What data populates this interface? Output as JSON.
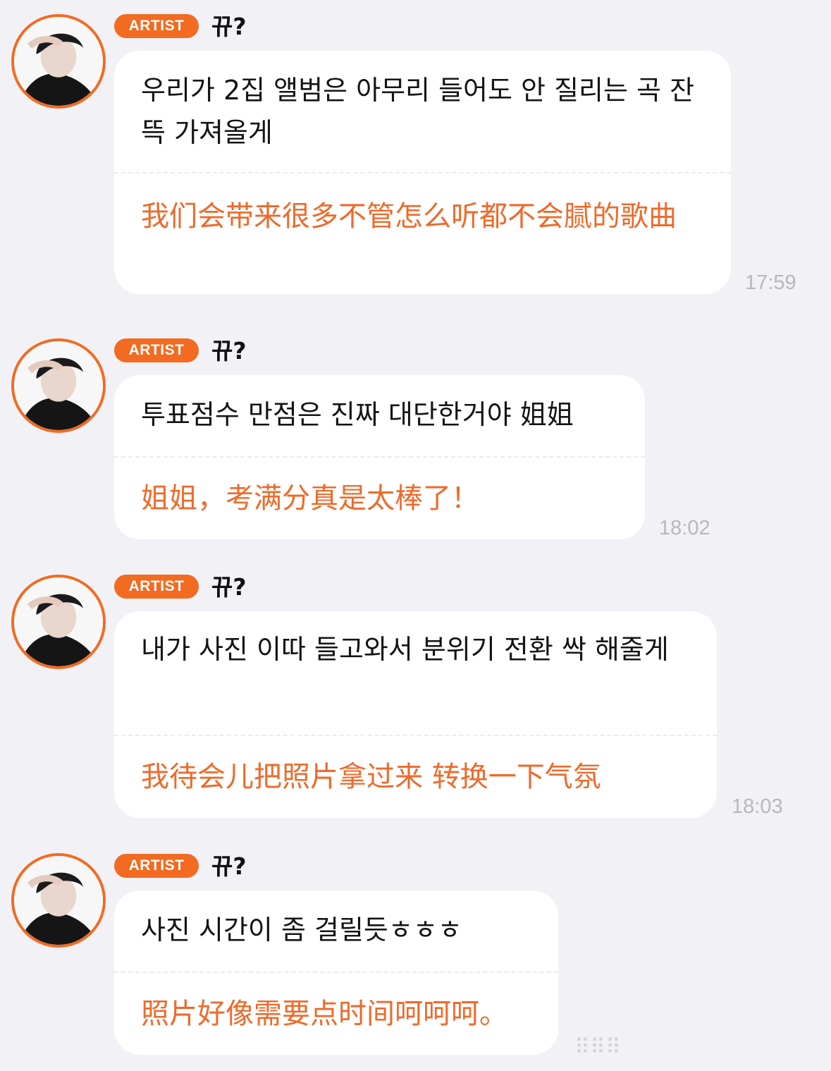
{
  "colors": {
    "accent": "#f26b21",
    "translation": "#ee6a2a",
    "background": "#f2f1f6"
  },
  "messages": [
    {
      "badge": "ARTIST",
      "name": "뀨?",
      "korean": "우리가 2집 앨범은 아무리 들어도 안 질리는 곡 잔뜩 가져올게",
      "chinese": "我们会带来很多不管怎么听都不会腻的歌曲",
      "time": "17:59"
    },
    {
      "badge": "ARTIST",
      "name": "뀨?",
      "korean": "투표점수 만점은 진짜 대단한거야 姐姐",
      "chinese": "姐姐，考满分真是太棒了！",
      "time": "18:02"
    },
    {
      "badge": "ARTIST",
      "name": "뀨?",
      "korean": "내가 사진 이따 들고와서 분위기 전환 싹 해줄게",
      "chinese": "我待会儿把照片拿过来 转换一下气氛",
      "time": "18:03"
    },
    {
      "badge": "ARTIST",
      "name": "뀨?",
      "korean": "사진 시간이 좀 걸릴듯ㅎㅎㅎ",
      "chinese": "照片好像需要点时间呵呵呵。",
      "time": ""
    }
  ],
  "watermark": "⠿⠿⠿"
}
